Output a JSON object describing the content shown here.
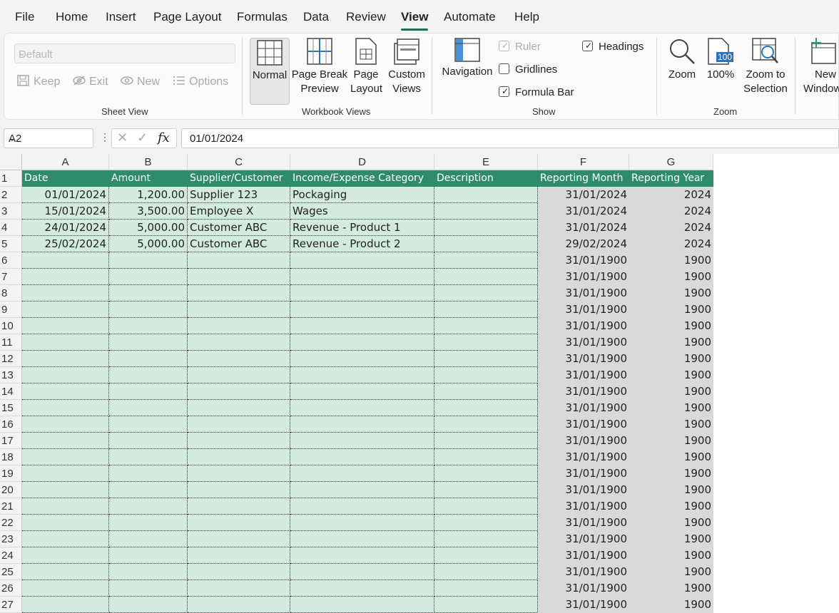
{
  "menu": {
    "tabs": [
      "File",
      "Home",
      "Insert",
      "Page Layout",
      "Formulas",
      "Data",
      "Review",
      "View",
      "Automate",
      "Help"
    ],
    "active": "View"
  },
  "ribbon": {
    "sheet_view": {
      "label": "Sheet View",
      "dropdown_value": "Default",
      "buttons": [
        "Keep",
        "Exit",
        "New",
        "Options"
      ]
    },
    "workbook_views": {
      "label": "Workbook Views",
      "normal": "Normal",
      "page_break_1": "Page Break",
      "page_break_2": "Preview",
      "page_layout_1": "Page",
      "page_layout_2": "Layout",
      "custom_views_1": "Custom",
      "custom_views_2": "Views"
    },
    "show": {
      "label": "Show",
      "navigation": "Navigation",
      "ruler": "Ruler",
      "gridlines": "Gridlines",
      "formula_bar": "Formula Bar",
      "headings": "Headings"
    },
    "zoom": {
      "label": "Zoom",
      "zoom": "Zoom",
      "hundred": "100%",
      "hundred_badge": "100",
      "zoom_sel_1": "Zoom to",
      "zoom_sel_2": "Selection"
    },
    "window": {
      "new_1": "New",
      "new_2": "Window"
    }
  },
  "formula_bar": {
    "name_box": "A2",
    "fx": "fx",
    "value": "01/01/2024"
  },
  "grid": {
    "columns": [
      "A",
      "B",
      "C",
      "D",
      "E",
      "F",
      "G"
    ],
    "headers": [
      "Date",
      "Amount",
      "Supplier/Customer",
      "Income/Expense Category",
      "Description",
      "Reporting Month",
      "Reporting Year"
    ],
    "rows": [
      [
        "01/01/2024",
        "1,200.00",
        "Supplier 123",
        "Pockaging",
        "",
        "31/01/2024",
        "2024"
      ],
      [
        "15/01/2024",
        "3,500.00",
        "Employee X",
        "Wages",
        "",
        "31/01/2024",
        "2024"
      ],
      [
        "24/01/2024",
        "5,000.00",
        "Customer ABC",
        "Revenue - Product 1",
        "",
        "31/01/2024",
        "2024"
      ],
      [
        "25/02/2024",
        "5,000.00",
        "Customer ABC",
        "Revenue - Product 2",
        "",
        "29/02/2024",
        "2024"
      ]
    ],
    "empty_month": "31/01/1900",
    "empty_year": "1900",
    "row_numbers": [
      "1",
      "2",
      "3",
      "4",
      "5",
      "6",
      "7",
      "8",
      "9",
      "10",
      "11",
      "12",
      "13",
      "14",
      "15",
      "16",
      "17",
      "18",
      "19",
      "20",
      "21",
      "22",
      "23",
      "24",
      "25",
      "26",
      "27"
    ]
  }
}
